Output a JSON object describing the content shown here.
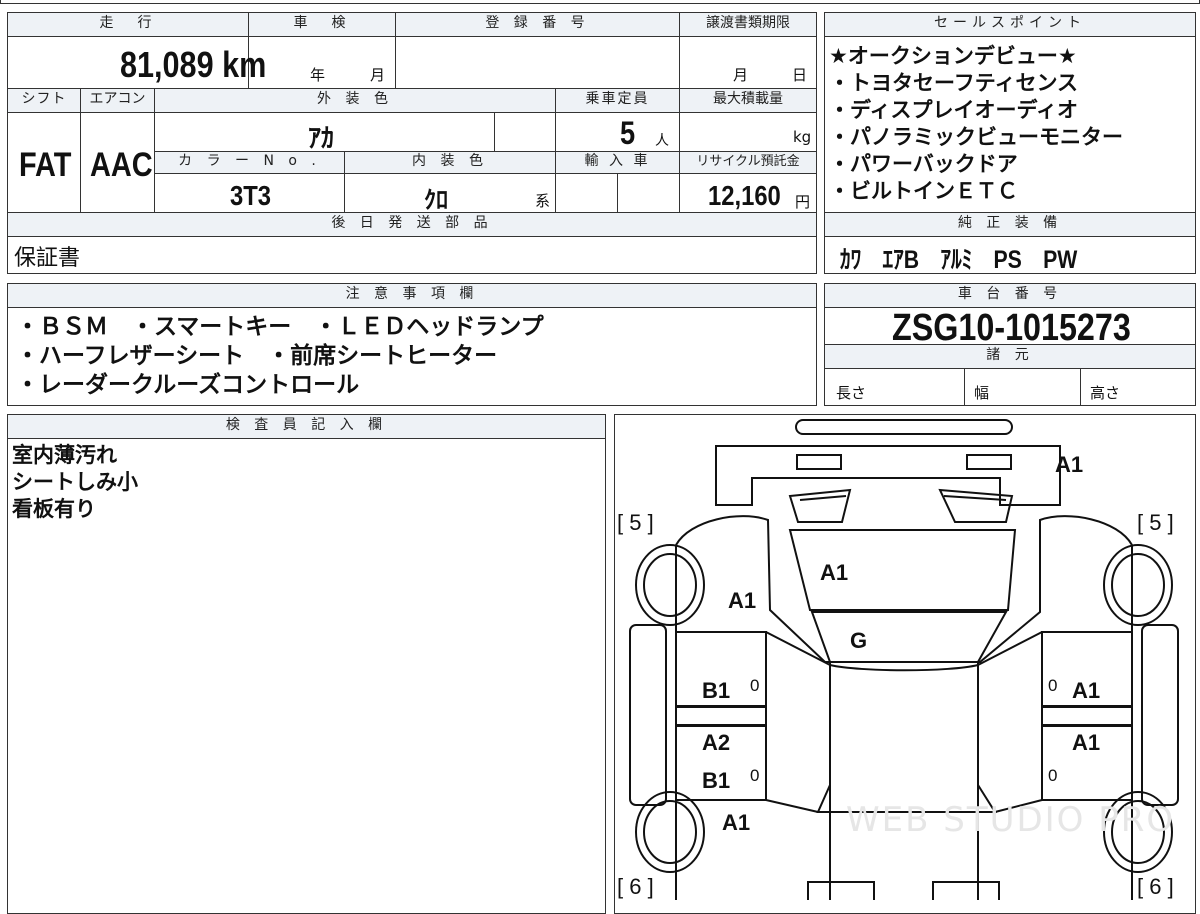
{
  "header": {
    "mileage_label": "走　行",
    "inspection_label": "車　検",
    "reg_label": "登 録 番 号",
    "transfer_label": "譲渡書類期限",
    "sales_label": "セールスポイント"
  },
  "vehicle": {
    "mileage": "81,089 km",
    "inspection_year": "年",
    "inspection_month": "月",
    "transfer_month": "月",
    "transfer_day": "日",
    "shift_label": "シフト",
    "ac_label": "エアコン",
    "color_label": "外 装 色",
    "capacity_label": "乗車定員",
    "max_load_label": "最大積載量",
    "shift": "FAT",
    "ac": "AAC",
    "color": "ｱｶ",
    "capacity": "5",
    "capacity_unit": "人",
    "load_unit": "kg",
    "color_no_label": "カ ラ ー N o .",
    "interior_label": "内 装 色",
    "import_label": "輸 入 車",
    "recycle_label": "リサイクル預託金",
    "color_no": "3T3",
    "interior": "ｸﾛ",
    "interior_suffix": "系",
    "recycle": "12,160",
    "recycle_unit": "円"
  },
  "sales_points": [
    "★オークションデビュー★",
    "・トヨタセーフティセンス",
    "・ディスプレイオーディオ",
    "・パノラミックビューモニター",
    "・パワーバックドア",
    "・ビルトインＥＴＣ"
  ],
  "later_parts": {
    "label": "後 日 発 送 部 品",
    "value": "保証書"
  },
  "equipment": {
    "label": "純 正 装 備",
    "value": "ｶﾜ　ｴｱB　ｱﾙﾐ　PS　PW"
  },
  "notes": {
    "label": "注 意 事 項 欄",
    "lines": [
      "・ＢＳＭ　・スマートキー　・ＬＥＤヘッドランプ",
      "・ハーフレザーシート　・前席シートヒーター",
      "・レーダークルーズコントロール"
    ]
  },
  "chassis": {
    "label": "車 台 番 号",
    "value": "ZSG10-1015273"
  },
  "specs": {
    "label": "諸 元",
    "length": "長さ",
    "width": "幅",
    "height": "高さ"
  },
  "inspector": {
    "label": "検 査 員 記 入 欄",
    "lines": [
      "室内薄汚れ",
      "シートしみ小",
      "看板有り"
    ]
  },
  "diagram": {
    "tire_fl": "[ 5 ]",
    "tire_fr": "[ 5 ]",
    "tire_rl": "[ 6 ]",
    "tire_rr": "[ 6 ]",
    "marks": {
      "front_bumper": "A1",
      "hood": "A1",
      "left_front_fender": "A1",
      "roof": "G",
      "left_front_door": "B1",
      "left_rear_door_a": "A2",
      "left_rear_door_b": "B1",
      "left_quarter": "A1",
      "right_front_door": "A1",
      "right_rear_door": "A1"
    },
    "zero": "0"
  },
  "watermark": "WEB STUDIO PRO"
}
